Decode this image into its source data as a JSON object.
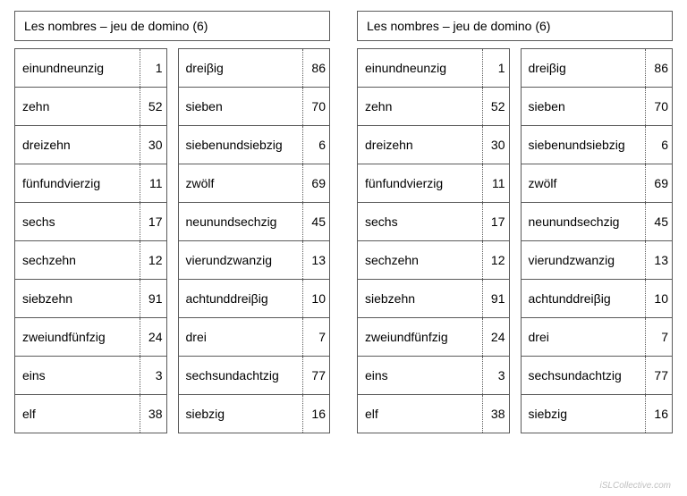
{
  "title": "Les nombres – jeu de domino (6)",
  "watermark": "iSLCollective.com",
  "columns": [
    [
      {
        "word": "einundneunzig",
        "num": 1
      },
      {
        "word": "zehn",
        "num": 52
      },
      {
        "word": "dreizehn",
        "num": 30
      },
      {
        "word": "fünfundvierzig",
        "num": 11
      },
      {
        "word": "sechs",
        "num": 17
      },
      {
        "word": "sechzehn",
        "num": 12
      },
      {
        "word": "siebzehn",
        "num": 91
      },
      {
        "word": "zweiundfünfzig",
        "num": 24
      },
      {
        "word": "eins",
        "num": 3
      },
      {
        "word": "elf",
        "num": 38
      }
    ],
    [
      {
        "word": "dreiβig",
        "num": 86
      },
      {
        "word": "sieben",
        "num": 70
      },
      {
        "word": "siebenundsiebzig",
        "num": 6
      },
      {
        "word": "zwölf",
        "num": 69
      },
      {
        "word": "neunundsechzig",
        "num": 45
      },
      {
        "word": "vierundzwanzig",
        "num": 13
      },
      {
        "word": "achtunddreiβig",
        "num": 10
      },
      {
        "word": "drei",
        "num": 7
      },
      {
        "word": "sechsundachtzig",
        "num": 77
      },
      {
        "word": "siebzig",
        "num": 16
      }
    ]
  ]
}
